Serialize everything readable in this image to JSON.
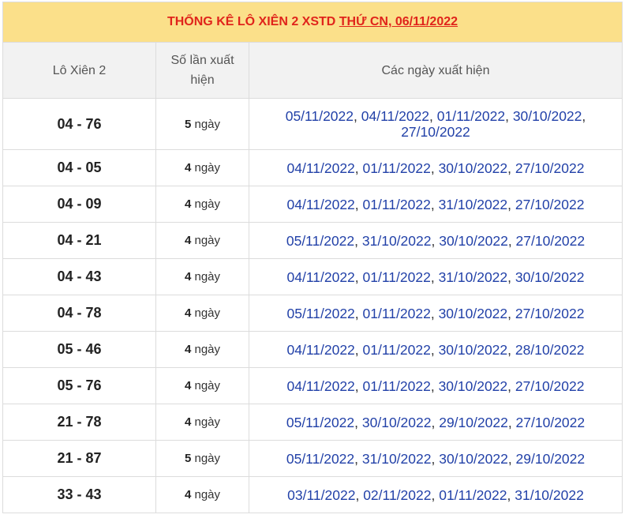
{
  "title": {
    "main": "THỐNG KÊ LÔ XIÊN 2 XSTD ",
    "date_link": "THỨ CN, 06/11/2022"
  },
  "headers": {
    "pair": "Lô Xiên 2",
    "count": "Số lần xuất hiện",
    "dates": "Các ngày xuất hiện"
  },
  "unit": "ngày",
  "rows": [
    {
      "pair": "04 - 76",
      "count": "5",
      "dates": [
        "05/11/2022",
        "04/11/2022",
        "01/11/2022",
        "30/10/2022",
        "27/10/2022"
      ]
    },
    {
      "pair": "04 - 05",
      "count": "4",
      "dates": [
        "04/11/2022",
        "01/11/2022",
        "30/10/2022",
        "27/10/2022"
      ]
    },
    {
      "pair": "04 - 09",
      "count": "4",
      "dates": [
        "04/11/2022",
        "01/11/2022",
        "31/10/2022",
        "27/10/2022"
      ]
    },
    {
      "pair": "04 - 21",
      "count": "4",
      "dates": [
        "05/11/2022",
        "31/10/2022",
        "30/10/2022",
        "27/10/2022"
      ]
    },
    {
      "pair": "04 - 43",
      "count": "4",
      "dates": [
        "04/11/2022",
        "01/11/2022",
        "31/10/2022",
        "30/10/2022"
      ]
    },
    {
      "pair": "04 - 78",
      "count": "4",
      "dates": [
        "05/11/2022",
        "01/11/2022",
        "30/10/2022",
        "27/10/2022"
      ]
    },
    {
      "pair": "05 - 46",
      "count": "4",
      "dates": [
        "04/11/2022",
        "01/11/2022",
        "30/10/2022",
        "28/10/2022"
      ]
    },
    {
      "pair": "05 - 76",
      "count": "4",
      "dates": [
        "04/11/2022",
        "01/11/2022",
        "30/10/2022",
        "27/10/2022"
      ]
    },
    {
      "pair": "21 - 78",
      "count": "4",
      "dates": [
        "05/11/2022",
        "30/10/2022",
        "29/10/2022",
        "27/10/2022"
      ]
    },
    {
      "pair": "21 - 87",
      "count": "5",
      "dates": [
        "05/11/2022",
        "31/10/2022",
        "30/10/2022",
        "29/10/2022"
      ]
    },
    {
      "pair": "33 - 43",
      "count": "4",
      "dates": [
        "03/11/2022",
        "02/11/2022",
        "01/11/2022",
        "31/10/2022"
      ]
    }
  ],
  "colors": {
    "title_bg": "#fbe08a",
    "title_text": "#e0241b",
    "header_bg": "#f2f2f2",
    "link": "#2241a8"
  }
}
